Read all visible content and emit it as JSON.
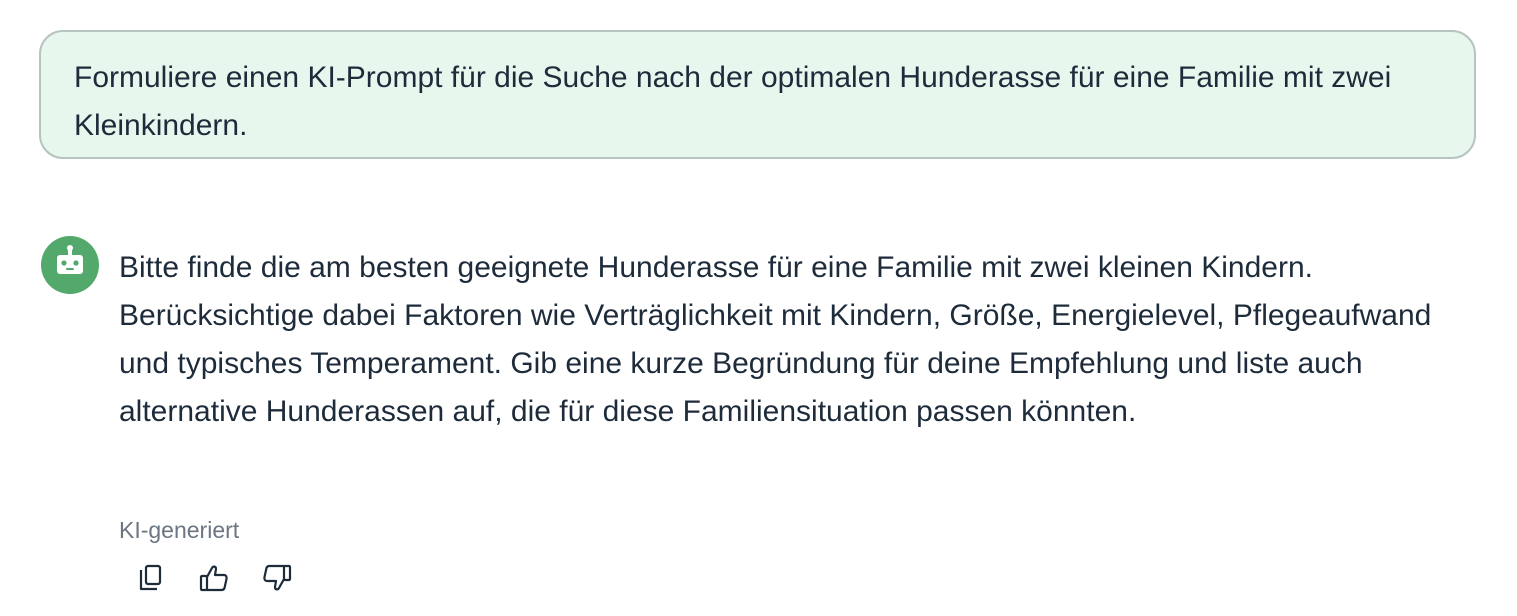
{
  "user_message": {
    "text": "Formuliere einen KI-Prompt für die Suche nach der optimalen Hunderasse für eine Familie mit zwei Kleinkindern."
  },
  "assistant_message": {
    "avatar_icon": "robot-icon",
    "text": "Bitte finde die am besten geeignete Hunderasse für eine Familie mit zwei kleinen Kindern. Berücksichtige dabei Faktoren wie Verträglichkeit mit Kindern, Größe, Energielevel, Pflegeaufwand und typisches Temperament. Gib eine kurze Begründung für deine Empfehlung und liste auch alternative Hunderassen auf, die für diese Familiensituation passen könnten.",
    "meta_label": "KI-generiert",
    "actions": [
      {
        "icon": "copy-icon"
      },
      {
        "icon": "thumbs-up-icon"
      },
      {
        "icon": "thumbs-down-icon"
      }
    ]
  },
  "colors": {
    "user_bubble_bg": "#e8f7ee",
    "user_bubble_border": "#b6c4c0",
    "avatar_bg": "#52a96b",
    "text": "#1d2b3a",
    "muted_text": "#6b7682"
  }
}
